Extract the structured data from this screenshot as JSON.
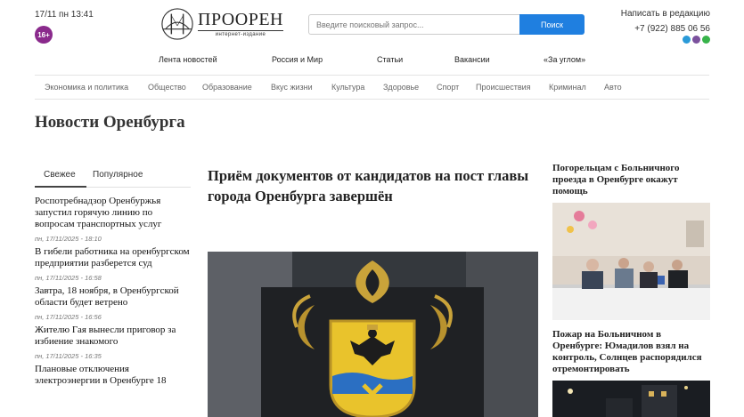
{
  "header": {
    "datetime": "17/11 пн 13:41",
    "age_rating": "16+",
    "logo_name": "ПРООРЕН",
    "logo_sub": "интернет-издание",
    "search_placeholder": "Введите поисковый запрос...",
    "search_button": "Поиск",
    "write_link": "Написать в редакцию",
    "phone": "+7 (922) 885 06 56",
    "messengers": [
      {
        "icon": "telegram-icon",
        "color": "#2a9ad8"
      },
      {
        "icon": "viber-icon",
        "color": "#7b519d"
      },
      {
        "icon": "whatsapp-icon",
        "color": "#37b34a"
      }
    ]
  },
  "main_nav": [
    "Лента новостей",
    "Россия и Мир",
    "Статьи",
    "Вакансии",
    "«За углом»"
  ],
  "category_nav": [
    "Экономика и политика",
    "Общество",
    "Образование",
    "Вкус жизни",
    "Культура",
    "Здоровье",
    "Спорт",
    "Происшествия",
    "Криминал",
    "Авто"
  ],
  "page_title": "Новости Оренбурга",
  "tabs": {
    "fresh": "Свежее",
    "popular": "Популярное"
  },
  "news": [
    {
      "title": "Роспотребнадзор Оренбуржья запустил горячую линию по вопросам транспортных услуг",
      "time": "пн, 17/11/2025 - 18:10"
    },
    {
      "title": "В гибели работника на оренбургском предприятии разберется суд",
      "time": "пн, 17/11/2025 - 16:58"
    },
    {
      "title": "Завтра, 18 ноября, в Оренбургской области будет ветрено",
      "time": "пн, 17/11/2025 - 16:56"
    },
    {
      "title": "Жителю Гая вынесли приговор за избиение знакомого",
      "time": "пн, 17/11/2025 - 16:35"
    },
    {
      "title": "Плановые отключения электроэнергии в Оренбурге 18",
      "time": ""
    }
  ],
  "lead": {
    "title": "Приём документов от кандидатов на пост главы города Оренбурга завершён"
  },
  "side_news": [
    {
      "title": "Погорельцам с Больничного проезда в Оренбурге окажут помощь"
    },
    {
      "title": "Пожар на Больничном в Оренбурге: Юмадилов взял на контроль, Солнцев распорядился отремонтировать"
    }
  ]
}
